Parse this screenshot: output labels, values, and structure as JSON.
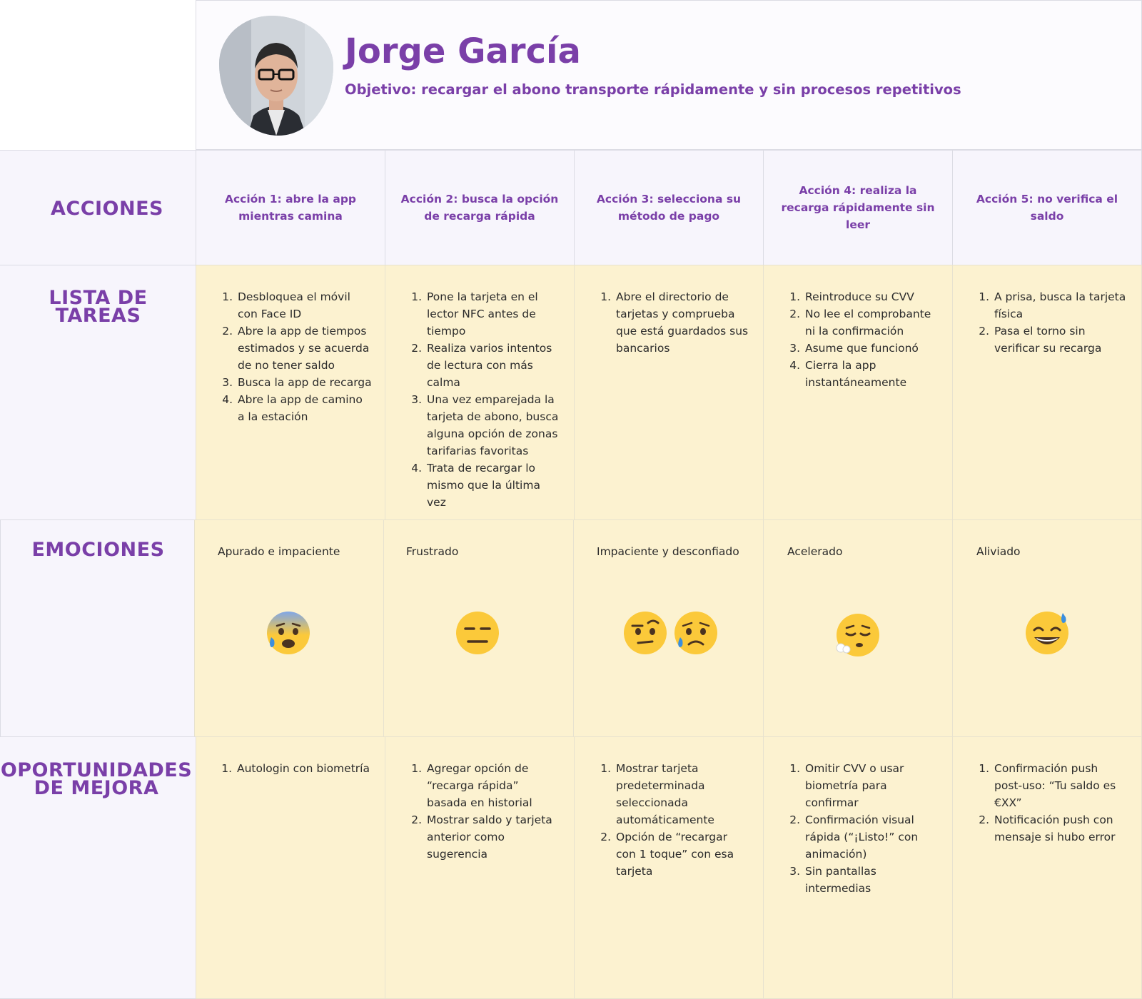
{
  "persona": {
    "name": "Jorge García",
    "goal": "Objetivo: recargar el abono transporte rápidamente y sin procesos repetitivos"
  },
  "rows": {
    "acciones": "ACCIONES",
    "tareas": "LISTA DE TAREAS",
    "emociones": "EMOCIONES",
    "oportunidades": "OPORTUNIDADES DE MEJORA"
  },
  "actions": [
    "Acción 1: abre la app mientras camina",
    "Acción 2: busca la opción de recarga rápida",
    "Acción 3: selecciona su método de pago",
    "Acción 4: realiza la recarga rápidamente sin leer",
    "Acción 5: no verifica el saldo"
  ],
  "tasks": [
    [
      "Desbloquea el móvil con Face ID",
      "Abre la app de tiempos estimados y se acuerda de no tener saldo",
      "Busca la app de recarga",
      "Abre la app de camino a la estación"
    ],
    [
      "Pone la tarjeta en el lector NFC antes de tiempo",
      "Realiza varios intentos de lectura con más calma",
      "Una vez emparejada la tarjeta de abono, busca alguna opción de zonas tarifarias favoritas",
      "Trata de recargar lo mismo que  la última vez"
    ],
    [
      "Abre el directorio de tarjetas y comprueba que está guardados sus bancarios"
    ],
    [
      "Reintroduce su CVV",
      "No lee el comprobante ni la confirmación",
      "Asume que funcionó",
      "Cierra la app instantáneamente"
    ],
    [
      "A prisa, busca la tarjeta física",
      "Pasa el torno sin verificar su recarga"
    ]
  ],
  "emotions": [
    {
      "label": "Apurado e impaciente",
      "icons": [
        "anxious-sweat-face-icon"
      ]
    },
    {
      "label": "Frustrado",
      "icons": [
        "expressionless-face-icon"
      ]
    },
    {
      "label": "Impaciente y desconfiado",
      "icons": [
        "raised-eyebrow-face-icon",
        "sad-tear-face-icon"
      ]
    },
    {
      "label": "Acelerado",
      "icons": [
        "exhaling-face-icon"
      ]
    },
    {
      "label": "Aliviado",
      "icons": [
        "grinning-sweat-face-icon"
      ]
    }
  ],
  "opportunities": [
    [
      "Autologin con biometría"
    ],
    [
      "Agregar  opción de “recarga rápida” basada en historial",
      " Mostrar saldo y tarjeta anterior como sugerencia"
    ],
    [
      "Mostrar tarjeta predeterminada seleccionada automáticamente",
      "Opción de “recargar con 1 toque” con esa tarjeta"
    ],
    [
      "Omitir CVV o usar biometría para confirmar",
      "Confirmación visual rápida (“¡Listo!” con animación)",
      "Sin pantallas intermedias"
    ],
    [
      "Confirmación push post-uso: “Tu saldo es €XX”",
      "Notificación push con mensaje si hubo error"
    ]
  ],
  "colors": {
    "accent": "#7a3fa8",
    "lavender": "#f7f5fc",
    "cream": "#fcf2d0",
    "emoji_yellow": "#fbc93a"
  }
}
